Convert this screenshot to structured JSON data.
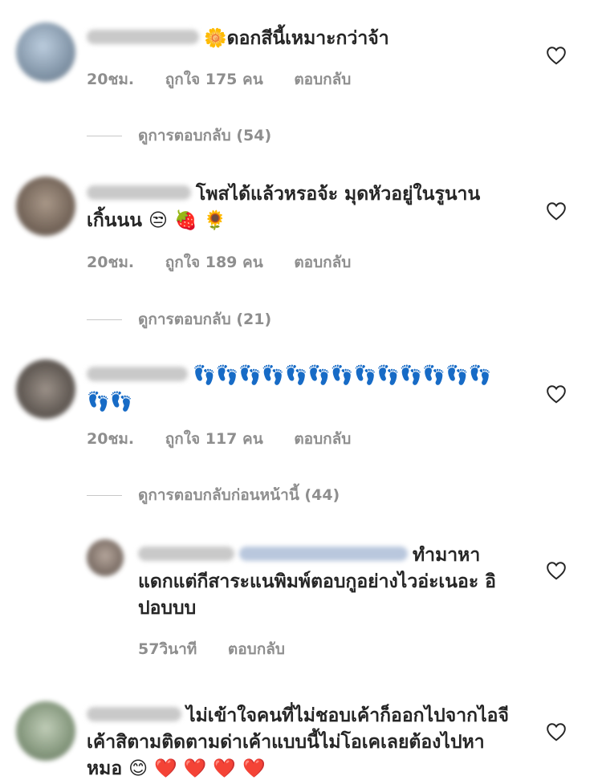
{
  "comments": [
    {
      "text": "🌼ดอกสีนี้เหมาะกว่าจ้า",
      "time": "20ชม.",
      "likes": "ถูกใจ 175 คน",
      "reply": "ตอบกลับ",
      "view_replies": "ดูการตอบกลับ (54)",
      "avatar_color": "#8aa0b5"
    },
    {
      "text": "โพสได้แล้วหรอจ้ะ มุดหัวอยู่ในรูนานเกิ้นนน 😒 🍓 🌻",
      "time": "20ชม.",
      "likes": "ถูกใจ 189 คน",
      "reply": "ตอบกลับ",
      "view_replies": "ดูการตอบกลับ (21)",
      "avatar_color": "#6e5a4a"
    },
    {
      "text": "👣👣👣👣👣👣👣👣👣👣👣👣👣👣👣",
      "time": "20ชม.",
      "likes": "ถูกใจ 117 คน",
      "reply": "ตอบกลับ",
      "view_replies": "ดูการตอบกลับก่อนหน้านี้ (44)",
      "avatar_color": "#5a4f48"
    }
  ],
  "reply_comment": {
    "text": "ทำมาหาแดกแต่กีสาระแนพิมพ์ตอบกูอย่างไวอ่ะเนอะ อิปอบบบ",
    "time": "57วินาที",
    "reply": "ตอบกลับ",
    "avatar_color": "#7a6a60"
  },
  "last_comment": {
    "text": "ไม่เข้าใจคนที่ไม่ชอบเค้าก็ออกไปจากไอจีเค้าสิตามติดตามด่าเค้าแบบนี้ไม่โอเคเลยต้องไปหาหมอ 😊 ❤️ ❤️ ❤️ ❤️",
    "avatar_color": "#7d8f74"
  },
  "colors": {
    "text": "#262626",
    "meta": "#8e8e8e",
    "divider": "#c7c7c7"
  },
  "icons": {
    "like": "heart-outline-icon"
  }
}
